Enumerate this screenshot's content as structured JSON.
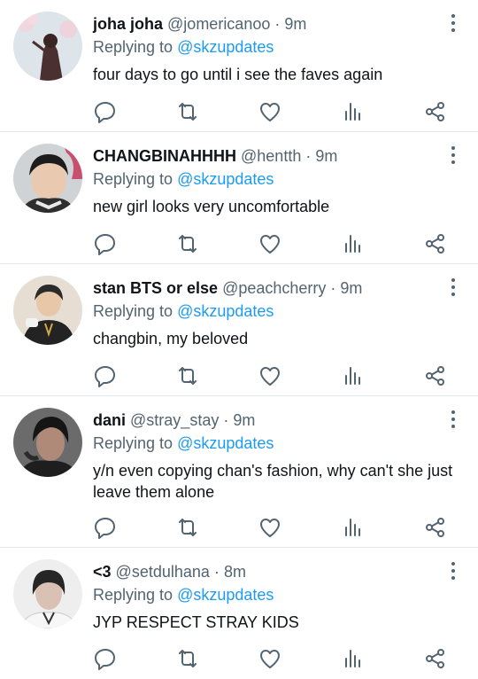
{
  "tweets": [
    {
      "name": "joha joha",
      "handle": "@jomericanoo",
      "time": "9m",
      "reply_prefix": "Replying to",
      "reply_to": "@skzupdates",
      "text": "four days to go until i see the faves again",
      "avatar": "avatar-woman-icon"
    },
    {
      "name": "CHANGBINAHHHH",
      "handle": "@hentth",
      "time": "9m",
      "reply_prefix": "Replying to",
      "reply_to": "@skzupdates",
      "text": "new girl looks very uncomfortable",
      "avatar": "avatar-man-icon"
    },
    {
      "name": "stan BTS or else",
      "handle": "@peachcherry",
      "time": "9m",
      "reply_prefix": "Replying to",
      "reply_to": "@skzupdates",
      "text": "changbin, my beloved",
      "avatar": "avatar-man-icon"
    },
    {
      "name": "dani",
      "handle": "@stray_stay",
      "time": "9m",
      "reply_prefix": "Replying to",
      "reply_to": "@skzupdates",
      "text": "y/n even copying chan's fashion, why can't she just leave them alone",
      "avatar": "avatar-man-icon"
    },
    {
      "name": "<3",
      "handle": "@setdulhana",
      "time": "8m",
      "reply_prefix": "Replying to",
      "reply_to": "@skzupdates",
      "text": "JYP RESPECT STRAY KIDS",
      "avatar": "avatar-man-icon"
    }
  ],
  "separator": "·",
  "icons": [
    "reply-icon",
    "retweet-icon",
    "like-icon",
    "analytics-icon",
    "share-icon",
    "more-options-icon"
  ],
  "colors": {
    "link": "#1d9bf0",
    "secondary": "#536471",
    "text": "#0f1419",
    "divider": "#e1e8ed"
  }
}
